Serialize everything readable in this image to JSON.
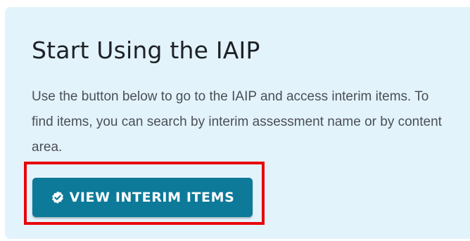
{
  "card": {
    "title": "Start Using the IAIP",
    "description": "Use the button below to go to the IAIP and access interim items. To find items, you can search by interim assessment name or by content area."
  },
  "button": {
    "label": "VIEW INTERIM ITEMS",
    "icon": "check-badge-icon"
  },
  "colors": {
    "card_background": "#e3f3fc",
    "button_background": "#0e7a99",
    "highlight_border": "#e8050a"
  }
}
